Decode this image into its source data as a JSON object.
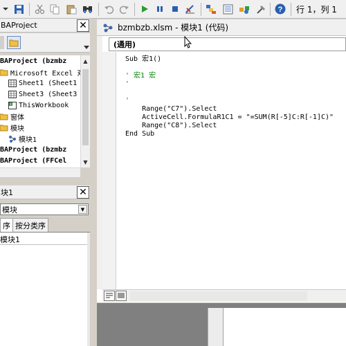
{
  "toolbar": {
    "buttons": [
      "dropdown-arrow-icon",
      "save-icon",
      "cut-icon",
      "copy-icon",
      "paste-icon",
      "find-icon",
      "undo-icon",
      "redo-icon",
      "run-icon",
      "pause-icon",
      "stop-icon",
      "design-mode-icon",
      "project-explorer-icon",
      "properties-window-icon",
      "object-browser-icon",
      "toolbox-icon",
      "help-icon"
    ],
    "position_status": "行 1，列 1"
  },
  "project_panel": {
    "title": "BAProject",
    "close": "✕",
    "tree": [
      {
        "label": "BAProject (bzmbz",
        "bold": true
      },
      {
        "label": "Microsoft Excel 对"
      },
      {
        "label": "Sheet1 (Sheet1"
      },
      {
        "label": "Sheet3 (Sheet3"
      },
      {
        "label": "ThisWorkbook"
      },
      {
        "label": "窗体"
      },
      {
        "label": "模块"
      },
      {
        "label": "模块1"
      },
      {
        "label": "BAProject (bzmbz",
        "bold": true
      },
      {
        "label": "BAProject (FFCel",
        "bold": true
      }
    ]
  },
  "properties_panel": {
    "title": "块1",
    "close": "✕",
    "object_combo": "模块",
    "tab_alpha": "序",
    "tab_category": "按分类序",
    "row_name": "模块1"
  },
  "code_window": {
    "title": "bzmbzb.xlsm - 模块1 (代码)",
    "proc_combo": "(通用)",
    "lines": [
      {
        "text": "Sub 宏1()",
        "type": "code"
      },
      {
        "text": "",
        "type": "code"
      },
      {
        "text": "' 宏1 宏",
        "type": "comment"
      },
      {
        "text": "'",
        "type": "comment"
      },
      {
        "text": "",
        "type": "code"
      },
      {
        "text": "'",
        "type": "comment"
      },
      {
        "text": "    Range(\"C7\").Select",
        "type": "code"
      },
      {
        "text": "    ActiveCell.FormulaR1C1 = \"=SUM(R[-5]C:R[-1]C)\"",
        "type": "code"
      },
      {
        "text": "    Range(\"C8\").Select",
        "type": "code"
      },
      {
        "text": "End Sub",
        "type": "code"
      }
    ]
  }
}
